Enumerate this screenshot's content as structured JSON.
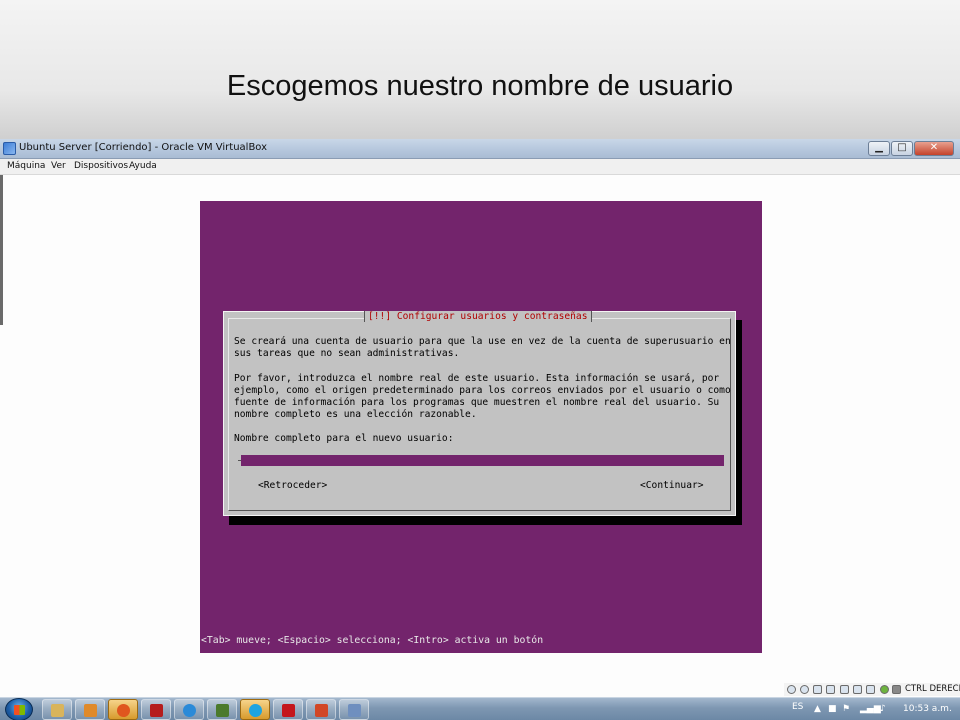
{
  "slide": {
    "title": "Escogemos nuestro nombre de usuario"
  },
  "window": {
    "title": "Ubuntu Server [Corriendo] - Oracle VM VirtualBox",
    "controls": [
      "minimize",
      "maximize",
      "close"
    ],
    "control_glyphs": {
      "minimize": "▁",
      "maximize": "□",
      "close": "✕"
    }
  },
  "menubar": {
    "items": [
      "Máquina",
      "Ver",
      "Dispositivos",
      "Ayuda"
    ]
  },
  "installer": {
    "dialog_title": "[!!] Configurar usuarios y contraseñas",
    "paragraph1": [
      "Se creará una cuenta de usuario para que la use en vez de la cuenta de superusuario en",
      "sus tareas que no sean administrativas."
    ],
    "paragraph2": [
      "Por favor, introduzca el nombre real de este usuario. Esta información se usará, por",
      "ejemplo, como el origen predeterminado para los correos enviados por el usuario o como",
      "fuente de información para los programas que muestren el nombre real del usuario. Su",
      "nombre completo es una elección razonable."
    ],
    "prompt": "Nombre completo para el nuevo usuario:",
    "input_value": "",
    "back_button": "<Retroceder>",
    "continue_button": "<Continuar>",
    "status_line": "<Tab> mueve; <Espacio> selecciona; <Intro> activa un botón",
    "colors": {
      "background": "#73246c",
      "dialog": "#c2c2c2",
      "title_text": "#b00000"
    }
  },
  "vbox_status": {
    "host_key": "CTRL DERECHA"
  },
  "taskbar": {
    "apps": [
      "windows-explorer",
      "media-player",
      "firefox",
      "flash",
      "dreamweaver",
      "skype",
      "acrobat-reader",
      "powerpoint",
      "virtualbox"
    ],
    "language": "ES",
    "time": "10:53 a.m."
  }
}
